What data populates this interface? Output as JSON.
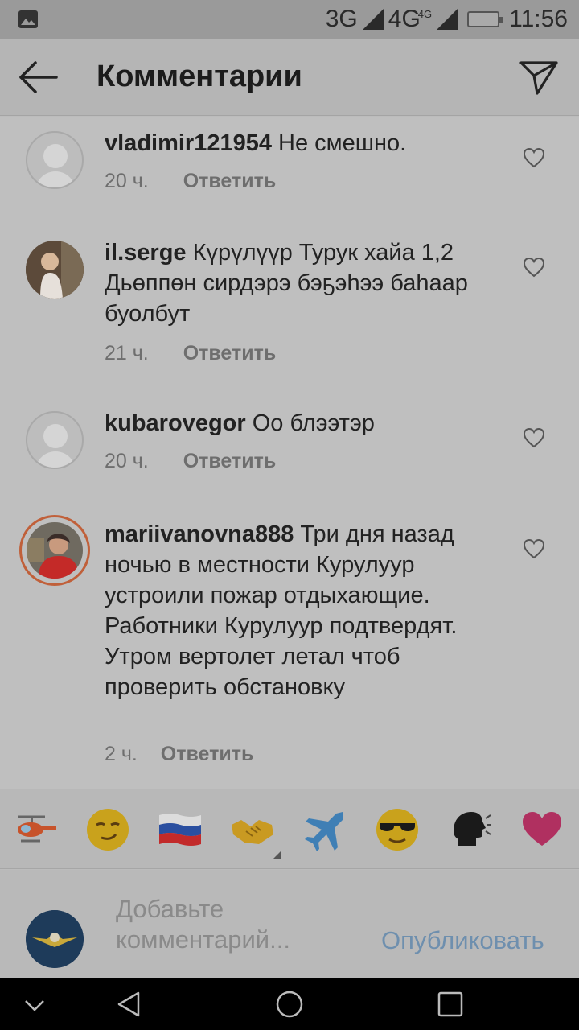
{
  "status_bar": {
    "network1": "3G",
    "network2": "4G",
    "network2_sup": "4G",
    "time": "11:56"
  },
  "header": {
    "title": "Комментарии"
  },
  "comments": [
    {
      "username": "vladimir121954",
      "text": "Не смешно.",
      "time": "20 ч.",
      "reply": "Ответить"
    },
    {
      "username": "il.serge",
      "text": "Күрүлүүр Турук хайа 1,2 Дьөппөн сирдэрэ бэҕэһээ баһаар буолбут",
      "time": "21 ч.",
      "reply": "Ответить"
    },
    {
      "username": "kubarovegor",
      "text": "Оо блээтэр",
      "time": "20 ч.",
      "reply": "Ответить"
    },
    {
      "username": "mariivanovna888",
      "text": "Три дня назад ночью в местности Курулуур устроили пожар отдыхающие. Работники Курулуур подтвердят. Утром вертолет летал чтоб проверить обстановку",
      "time": "2 ч.",
      "reply": "Ответить"
    }
  ],
  "quick_emojis": [
    "helicopter",
    "smirking-face",
    "russia-flag",
    "handshake",
    "airplane",
    "sunglasses-face",
    "speaking-head",
    "heart"
  ],
  "composer": {
    "placeholder": "Добавьте комментарий...",
    "publish_label": "Опубликовать"
  },
  "colors": {
    "publish": "#6e8fae",
    "story_ring": "#c0603a"
  }
}
